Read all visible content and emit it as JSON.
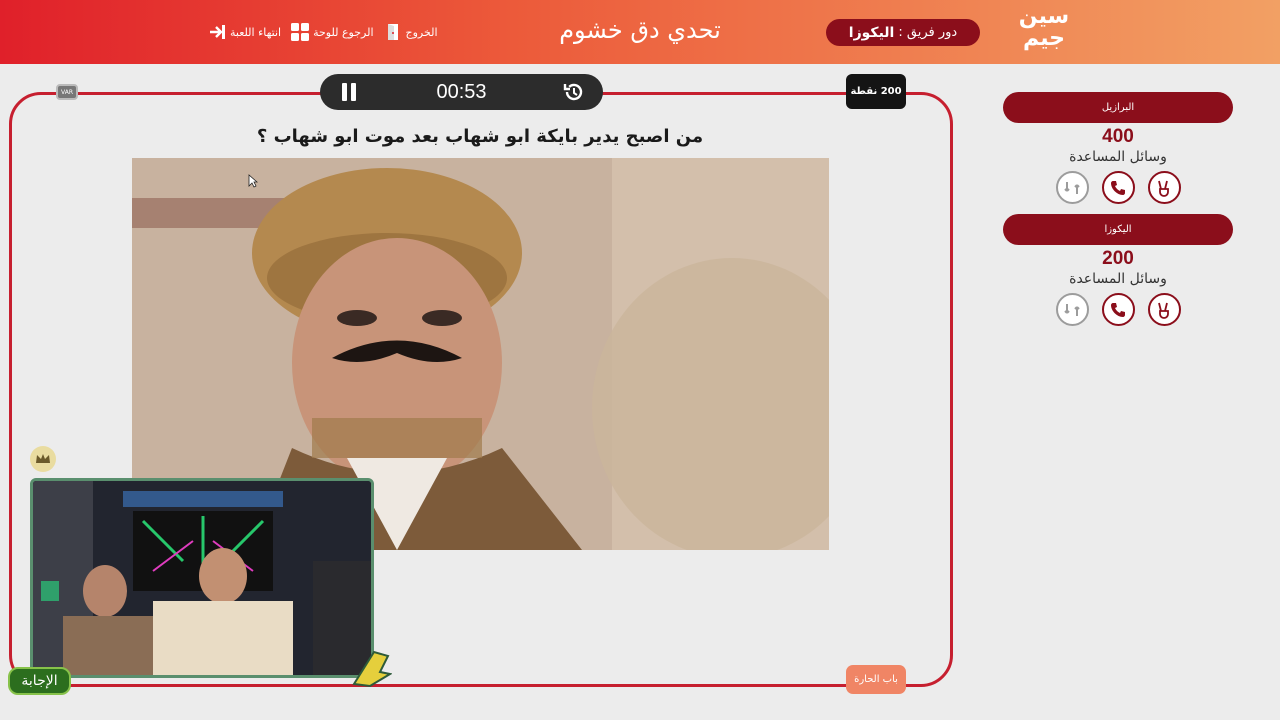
{
  "header": {
    "title": "تحدي دق خشوم",
    "logo_line1": "سين",
    "logo_line2": "جيم",
    "turn_label": "دور فريق :",
    "turn_team": "اليكوزا",
    "nav": [
      {
        "label": "انتهاء اللعبة",
        "icon": "end-game-icon"
      },
      {
        "label": "الرجوع للوحة",
        "icon": "grid-board-icon"
      },
      {
        "label": "الخروج",
        "icon": "exit-door-icon"
      }
    ],
    "colors": {
      "gradient_start": "#e0202a",
      "gradient_end": "#f2a064",
      "pill": "#8b0e1b"
    }
  },
  "question_panel": {
    "timer": "00:53",
    "points": "200 نقطة",
    "small_tag": "VAR",
    "question": "من اصبح يدير بايكة ابو شهاب بعد موت ابو شهاب ؟",
    "category": "باب الحارة",
    "answer_button": "الإجابة",
    "image_desc_icon": "question-photo",
    "border_color": "#c61f2f"
  },
  "teams": [
    {
      "name": "البرازيل",
      "score": "400",
      "helpers_label": "وسائل المساعدة",
      "lifelines": [
        {
          "icon": "peace-hand-icon",
          "used": false
        },
        {
          "icon": "phone-icon",
          "used": false
        },
        {
          "icon": "swap-icon",
          "used": true
        }
      ]
    },
    {
      "name": "اليكوزا",
      "score": "200",
      "helpers_label": "وسائل المساعدة",
      "lifelines": [
        {
          "icon": "peace-hand-icon",
          "used": false
        },
        {
          "icon": "phone-icon",
          "used": false
        },
        {
          "icon": "swap-icon",
          "used": true
        }
      ]
    }
  ]
}
